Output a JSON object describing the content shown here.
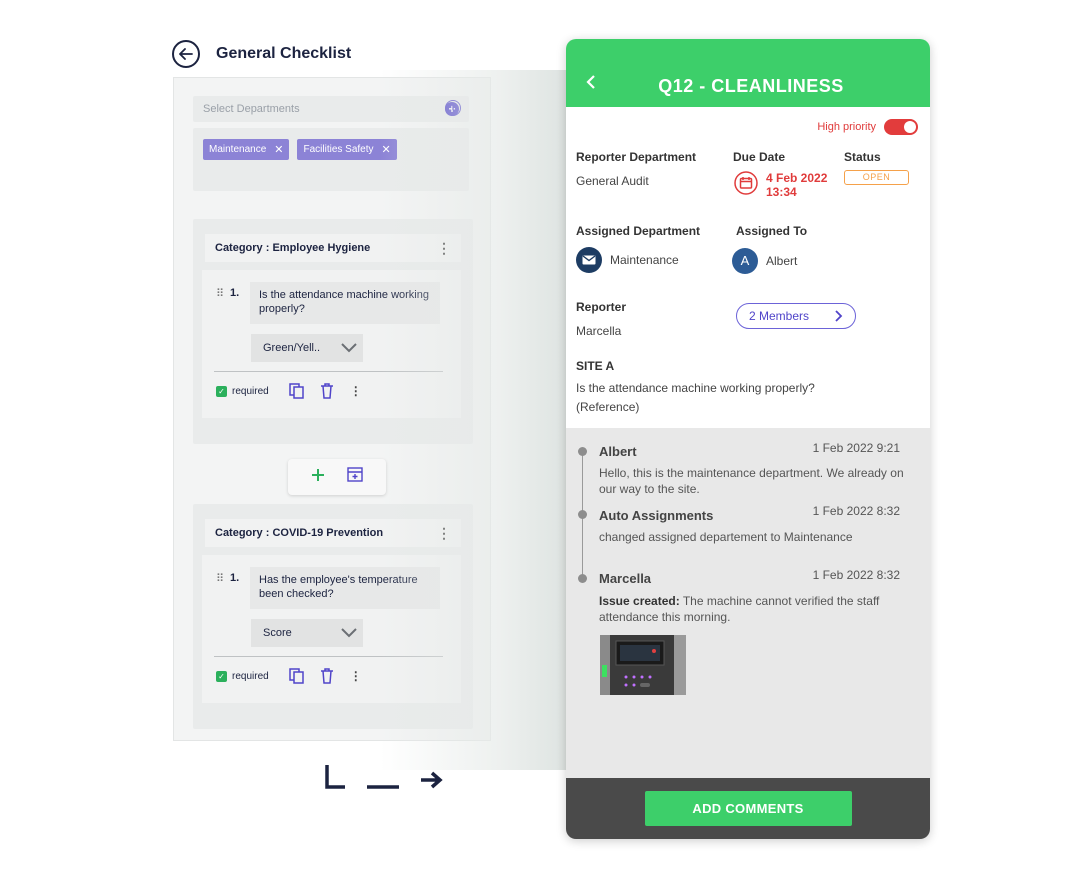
{
  "checklist": {
    "title": "General Checklist",
    "departments_placeholder": "Select Departments",
    "departments": [
      "Maintenance",
      "Facilities Safety"
    ],
    "categories": [
      {
        "title": "Category : Employee Hygiene",
        "question_number": "1.",
        "question": "Is the attendance machine working properly?",
        "answer_type": "Green/Yell..",
        "required_label": "required"
      },
      {
        "title": "Category : COVID-19 Prevention",
        "question_number": "1.",
        "question": "Has the employee's temperature been checked?",
        "answer_type": "Score",
        "required_label": "required"
      }
    ]
  },
  "issue": {
    "title": "Q12 - CLEANLINESS",
    "priority_label": "High priority",
    "reporter_department_label": "Reporter Department",
    "reporter_department": "General Audit",
    "due_date_label": "Due Date",
    "due_date": "4 Feb 2022",
    "due_time": "13:34",
    "status_label": "Status",
    "status": "OPEN",
    "assigned_department_label": "Assigned Department",
    "assigned_department": "Maintenance",
    "assigned_to_label": "Assigned To",
    "assigned_to": "Albert",
    "assigned_to_initial": "A",
    "reporter_label": "Reporter",
    "reporter": "Marcella",
    "members_button": "2 Members",
    "site_label": "SITE A",
    "site_question": "Is the attendance machine working properly?",
    "site_reference": "(Reference)"
  },
  "comments": [
    {
      "author": "Albert",
      "time": "1 Feb 2022 9:21",
      "text": "Hello, this is the maintenance department. We already on our way to the site."
    },
    {
      "author": "Auto Assignments",
      "time": "1 Feb 2022 8:32",
      "text": "changed assigned departement to Maintenance"
    },
    {
      "author": "Marcella",
      "time": "1 Feb 2022 8:32",
      "prefix": "Issue created:",
      "text": " The machine cannot verified the staff attendance this morning."
    }
  ],
  "footer": {
    "add_comments_label": "ADD COMMENTS"
  },
  "colors": {
    "accent_green": "#3dcf6a",
    "accent_purple": "#5044c9",
    "alert_red": "#e23c3c",
    "status_orange": "#f5a14a"
  }
}
